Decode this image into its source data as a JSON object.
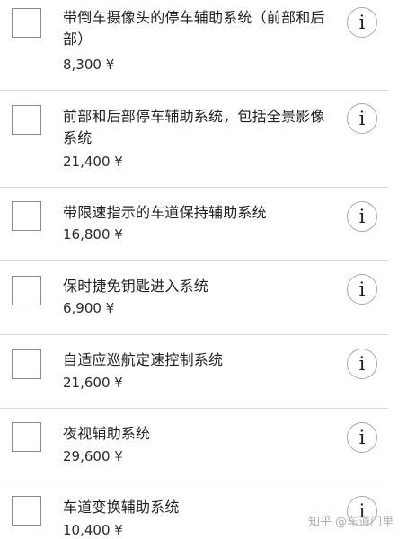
{
  "options": [
    {
      "title": "带倒车摄像头的停车辅助系统（前部和后部）",
      "price": "8,300 ¥",
      "info_icon": "i"
    },
    {
      "title": "前部和后部停车辅助系统，包括全景影像系统",
      "price": "21,400 ¥",
      "info_icon": "i"
    },
    {
      "title": "带限速指示的车道保持辅助系统",
      "price": "16,800 ¥",
      "info_icon": "i"
    },
    {
      "title": "保时捷免钥匙进入系统",
      "price": "6,900 ¥",
      "info_icon": "i"
    },
    {
      "title": "自适应巡航定速控制系统",
      "price": "21,600 ¥",
      "info_icon": "i"
    },
    {
      "title": "夜视辅助系统",
      "price": "29,600 ¥",
      "info_icon": "i"
    },
    {
      "title": "车道变换辅助系统",
      "price": "10,400 ¥",
      "info_icon": "i"
    }
  ],
  "watermark": "知乎 @车道门里"
}
